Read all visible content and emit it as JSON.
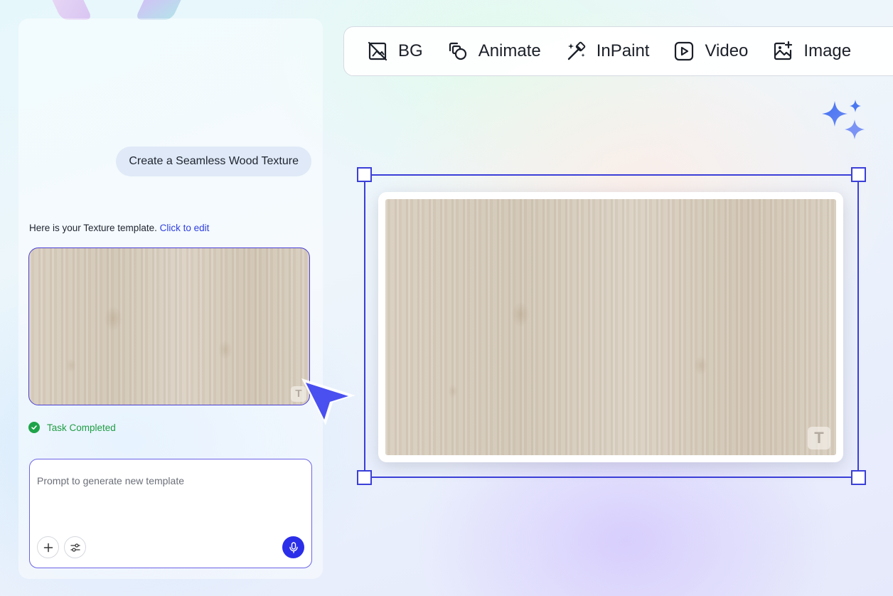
{
  "chat": {
    "user_message": "Create a Seamless Wood Texture",
    "reply_text": "Here is your Texture template.",
    "reply_link": "Click to edit",
    "thumbnail_alt": "Seamless wood texture template",
    "watermark_letter": "T",
    "status": "Task Completed"
  },
  "prompt": {
    "placeholder": "Prompt to generate new template"
  },
  "toolbar": {
    "tools": [
      {
        "label": "BG",
        "icon": "remove-background-icon"
      },
      {
        "label": "Animate",
        "icon": "animate-icon"
      },
      {
        "label": "InPaint",
        "icon": "magic-wand-icon"
      },
      {
        "label": "Video",
        "icon": "video-play-icon"
      },
      {
        "label": "Image",
        "icon": "image-add-icon"
      }
    ]
  },
  "canvas": {
    "watermark_letter": "T"
  },
  "colors": {
    "accent": "#3b3fd8",
    "success": "#1fa34a",
    "mic_button": "#2b2ee8"
  }
}
